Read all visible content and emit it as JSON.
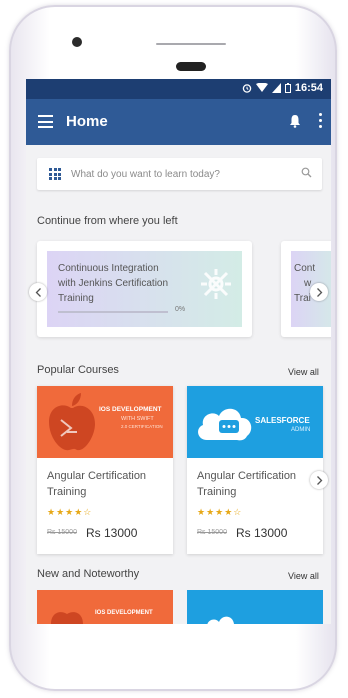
{
  "statusbar": {
    "time": "16:54"
  },
  "appbar": {
    "title": "Home"
  },
  "search": {
    "placeholder": "What do you want to learn today?"
  },
  "continue_section": {
    "title": "Continue from where you left",
    "cards": [
      {
        "title_lines": [
          "Continuous Integration",
          "with Jenkins Certification",
          "Training"
        ],
        "progress_label": "0%",
        "progress": 0.0
      },
      {
        "title_lines": [
          "Cont",
          "w",
          "Trai"
        ]
      }
    ]
  },
  "popular": {
    "title": "Popular Courses",
    "view_all": "View all",
    "courses": [
      {
        "banner_title": "IOS DEVELOPMENT",
        "banner_sub1": "WITH SWIFT",
        "banner_sub2": "2.0 CERTIFICATION",
        "title_lines": [
          "Angular Certification",
          "Training"
        ],
        "stars": "★★★★☆",
        "rating": 4,
        "old_price": "Rs 15000",
        "price": "Rs 13000",
        "banner_color": "#f06a3b"
      },
      {
        "banner_title": "SALESFORCE",
        "banner_sub1": "ADMIN",
        "title_lines": [
          "Angular Certification",
          "Training"
        ],
        "stars": "★★★★☆",
        "rating": 4,
        "old_price": "Rs 15000",
        "price": "Rs 13000",
        "banner_color": "#1e9fe0"
      }
    ]
  },
  "noteworthy": {
    "title": "New and Noteworthy",
    "view_all": "View all",
    "cards": [
      {
        "banner_title": "IOS DEVELOPMENT",
        "banner_color": "#f06a3b"
      },
      {
        "banner_color": "#1e9fe0"
      }
    ]
  },
  "colors": {
    "appbar": "#2f5a96",
    "statusbar": "#1d3e72",
    "accent": "#2f5a96",
    "star": "#e6a817"
  }
}
